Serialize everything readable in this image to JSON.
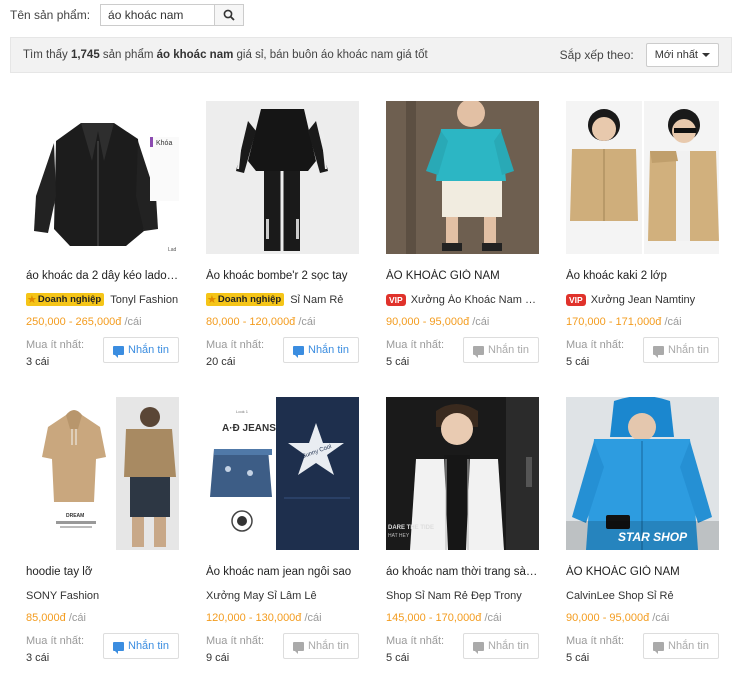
{
  "search": {
    "label": "Tên sản phẩm:",
    "value": "áo khoác nam",
    "button_icon": "search-icon"
  },
  "results": {
    "prefix": "Tìm thấy ",
    "count": "1,745",
    "middle": " sản phẩm ",
    "keyword": "áo khoác nam",
    "suffix": " giá sỉ, bán buôn áo khoác nam giá tốt"
  },
  "sort": {
    "label": "Sắp xếp theo:",
    "selected": "Mới nhất"
  },
  "moq_label": "Mua ít nhất:",
  "message_label": "Nhắn tin",
  "products": [
    {
      "title": "áo khoác da 2 dây kéo lados...",
      "badge": "biz",
      "badge_text": "Doanh nghiệp",
      "seller": "Tonyl Fashion",
      "price": "250,000 - 265,000đ",
      "unit": "/cái",
      "moq": "3 cái",
      "message_active": true,
      "image": "black-leather-jacket"
    },
    {
      "title": "Áo khoác bombe'r 2 sọc tay",
      "badge": "biz",
      "badge_text": "Doanh nghiệp",
      "seller": "Sỉ Nam Rẻ",
      "price": "80,000 - 120,000đ",
      "unit": "/cái",
      "moq": "20 cái",
      "message_active": true,
      "image": "bomber-jacket"
    },
    {
      "title": "ÁO KHOÁC GIÓ NAM",
      "badge": "vip",
      "badge_text": "VIP",
      "seller": "Xưởng Áo Khoác Nam Si...",
      "price": "90,000 - 95,000đ",
      "unit": "/cái",
      "moq": "5 cái",
      "message_active": false,
      "image": "teal-windbreaker"
    },
    {
      "title": "Áo khoác kaki 2 lớp",
      "badge": "vip",
      "badge_text": "VIP",
      "seller": "Xưởng Jean Namtiny",
      "price": "170,000 - 171,000đ",
      "unit": "/cái",
      "moq": "5 cái",
      "message_active": false,
      "image": "khaki-jacket"
    },
    {
      "title": "hoodie tay lỡ",
      "badge": "",
      "badge_text": "",
      "seller": "SONY Fashion",
      "price": "85,000đ",
      "unit": "/cái",
      "moq": "3 cái",
      "message_active": true,
      "image": "beige-hoodie"
    },
    {
      "title": "Áo khoác nam jean ngôi sao",
      "badge": "",
      "badge_text": "",
      "seller": "Xưởng May Sỉ Lâm Lê",
      "price": "120,000 - 130,000đ",
      "unit": "/cái",
      "moq": "9 cái",
      "message_active": false,
      "image": "denim-star-jacket"
    },
    {
      "title": "áo khoác nam thời trang sàn...",
      "badge": "",
      "badge_text": "",
      "seller": "Shop Sỉ Nam Rẻ Đẹp Trony",
      "price": "145,000 - 170,000đ",
      "unit": "/cái",
      "moq": "5 cái",
      "message_active": false,
      "image": "white-jacket"
    },
    {
      "title": "ÁO KHOÁC GIÓ NAM",
      "badge": "",
      "badge_text": "",
      "seller": "CalvinLee Shop Sỉ Rẻ",
      "price": "90,000 - 95,000đ",
      "unit": "/cái",
      "moq": "5 cái",
      "message_active": false,
      "image": "blue-windbreaker"
    }
  ],
  "image_text": {
    "p1_tag": "Khóa",
    "p1_corner": "Lad",
    "p6_brand": "A·Đ JEANS",
    "p6_small": "Look 1",
    "p6_logo": "Sunny Cool",
    "p7_text1": "DARE THE TIDE",
    "p7_text2": "HAT HEY",
    "p8_watermark": "STAR SHOP",
    "p5_caption": "DREAM"
  }
}
